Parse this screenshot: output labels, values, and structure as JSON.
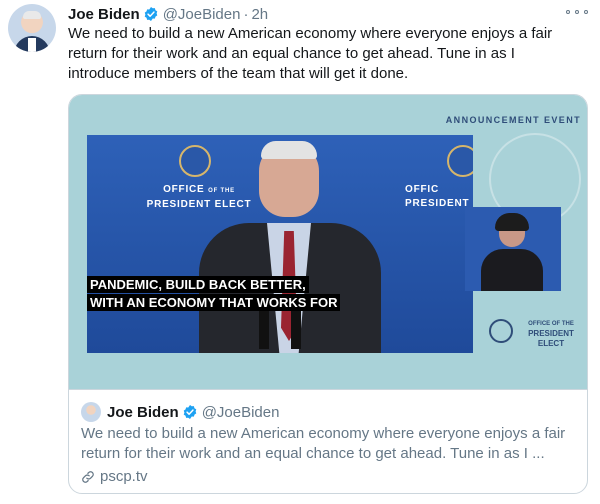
{
  "tweet": {
    "author": "Joe Biden",
    "handle": "@JoeBiden",
    "separator": "·",
    "time": "2h",
    "text_line1": "We need to build a new American economy where everyone enjoys a fair",
    "text_line2": "return for their work and an equal chance to get ahead. Tune in as I",
    "text_line3": "introduce members of the team that will get it done."
  },
  "media": {
    "label": "ANNOUNCEMENT EVENT",
    "backdrop_line1": "OFFICE",
    "backdrop_of": "OF THE",
    "backdrop_line2": "PRESIDENT ELECT",
    "backdrop_right_line1": "OFFIC",
    "backdrop_right_line2": "PRESIDENT",
    "caption_line1": "PANDEMIC, BUILD BACK BETTER,",
    "caption_line2": "WITH AN ECONOMY THAT WORKS FOR",
    "side_logo_line1": "OFFICE OF THE",
    "side_logo_line2": "PRESIDENT",
    "side_logo_line3": "ELECT"
  },
  "quote": {
    "author": "Joe Biden",
    "handle": "@JoeBiden",
    "text_line1": "We need to build a new American economy where everyone enjoys a fair",
    "text_line2": "return for their work and an equal chance to get ahead. Tune in as I ...",
    "link": "pscp.tv"
  },
  "icons": {
    "verified": "verified-badge-icon",
    "more": "more-options-icon",
    "link": "link-icon"
  },
  "colors": {
    "brand_blue": "#1da1f2",
    "secondary_text": "#657786",
    "border": "#ccd6dd",
    "media_bg": "#a9d2d8",
    "stage_blue": "#2e61b8"
  }
}
